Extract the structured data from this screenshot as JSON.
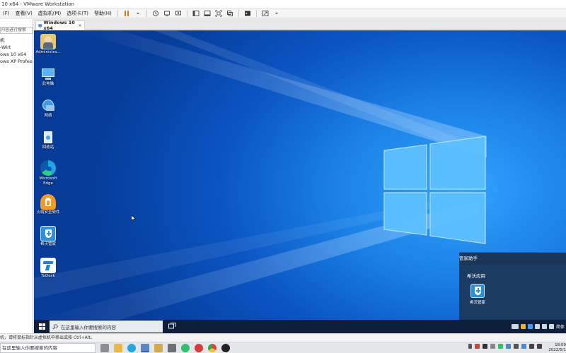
{
  "window": {
    "title": "10 x64 - VMware Workstation"
  },
  "menu": {
    "items": [
      "(F)",
      "查看(V)",
      "虚拟机(M)",
      "选项卡(T)",
      "帮助(H)"
    ]
  },
  "toolbar": {
    "icons": [
      "pause-icon",
      "dropdown-icon",
      "snapshot-icon",
      "revert-icon",
      "snapshot-manager-icon",
      "view-normal-icon",
      "view-console-icon",
      "fullscreen-icon",
      "unity-icon",
      "terminal-icon",
      "stretch-icon"
    ]
  },
  "library": {
    "search_placeholder": "内容进行搜索",
    "items": [
      "机",
      "-Wirt",
      "ows 10 x64",
      "ows XP Professic"
    ]
  },
  "tabs": [
    {
      "label": "Windows 10 x64"
    }
  ],
  "desktop": {
    "icons": [
      {
        "label": "Administra...",
        "icon": "user-folder-icon"
      },
      {
        "label": "此电脑",
        "icon": "computer-icon"
      },
      {
        "label": "网络",
        "icon": "network-icon"
      },
      {
        "label": "回收站",
        "icon": "recycle-bin-icon"
      },
      {
        "label": "Microsoft Edge",
        "icon": "edge-icon"
      },
      {
        "label": "火绒安全软件",
        "icon": "huorong-icon"
      },
      {
        "label": "希沃管家",
        "icon": "seewo-shield-icon"
      },
      {
        "label": "ToDesk",
        "icon": "todesk-icon"
      }
    ]
  },
  "notification": {
    "title": "管家助手",
    "section": "希沃应用",
    "app_label": "希沃管家"
  },
  "guest_taskbar": {
    "search_placeholder": "在这里输入你要搜索的内容",
    "ime": "简体"
  },
  "statusbar": {
    "text": "机，请将鼠标指针从虚拟机中移出或按 Ctrl+Alt。"
  },
  "host_taskbar": {
    "search_placeholder": "在这里输入你要搜索的内容",
    "clock_time": "18:09",
    "clock_date": "2022/5/1"
  },
  "colors": {
    "desktop_blue": "#0a55c4",
    "taskbar_dark": "#0d1f3a",
    "notif_bg": "#1c3b63",
    "pause_orange": "#d97a1e"
  }
}
